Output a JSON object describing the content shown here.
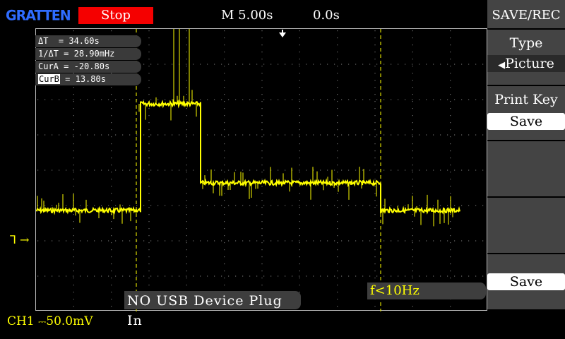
{
  "brand": {
    "logo_text": "GRATTEN"
  },
  "status": {
    "run_state": "Stop",
    "run_state_color": "#f50000"
  },
  "timebase": {
    "label": "M 5.00s",
    "offset": "0.0s"
  },
  "readouts": [
    {
      "label": "ΔT",
      "value": "= 34.60s"
    },
    {
      "label": "1/ΔT",
      "value": "= 28.90mHz"
    },
    {
      "label": "CurA",
      "value": "= -20.80s"
    },
    {
      "label": "CurB",
      "value": "= 13.80s",
      "highlighted": true
    }
  ],
  "trigger": {
    "marker_icon": "trigger-position-arrow-icon"
  },
  "channel_marker": {
    "text": "1"
  },
  "messages": {
    "usb": "NO USB Device Plug In",
    "frequency": "f<10Hz"
  },
  "channel_info": {
    "channel": "CH1",
    "scale": "50.0mV",
    "coupling_icon": "dc-coupling-icon"
  },
  "menu": {
    "title": "SAVE/REC",
    "items": [
      {
        "label": "Type",
        "value": "Picture",
        "selected_icon": "left-triangle-icon"
      },
      {
        "label": "Print Key",
        "value": "Save"
      },
      {
        "label": "",
        "value": ""
      },
      {
        "label": "",
        "value": ""
      },
      {
        "label": "",
        "value": "Save"
      }
    ]
  },
  "colors": {
    "trace": "#ffff00",
    "cursor": "#e6e600",
    "grid": "#6b6b6b",
    "menu_bg": "#444444"
  }
}
